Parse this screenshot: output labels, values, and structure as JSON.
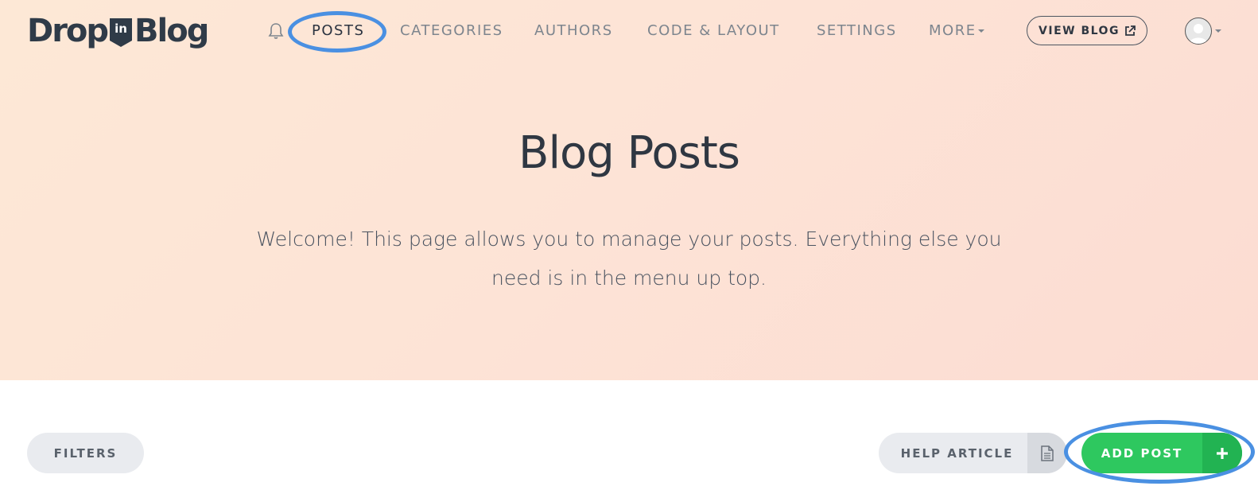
{
  "logo": {
    "part1": "Drop",
    "badge": "in",
    "part2": "Blog"
  },
  "nav": {
    "items": [
      {
        "label": "POSTS",
        "active": true
      },
      {
        "label": "CATEGORIES"
      },
      {
        "label": "AUTHORS"
      },
      {
        "label": "CODE & LAYOUT"
      },
      {
        "label": "SETTINGS"
      },
      {
        "label": "MORE"
      }
    ],
    "view_blog_label": "VIEW BLOG"
  },
  "hero": {
    "title": "Blog Posts",
    "lead": "Welcome! This page allows you to manage your posts. Everything else you need is in the menu up top."
  },
  "toolbar": {
    "filters_label": "FILTERS",
    "help_label": "HELP ARTICLE",
    "add_label": "ADD POST"
  },
  "colors": {
    "accent_green": "#2ec85f",
    "annotation_blue": "#4a90e2",
    "text_dark": "#2f3742"
  }
}
